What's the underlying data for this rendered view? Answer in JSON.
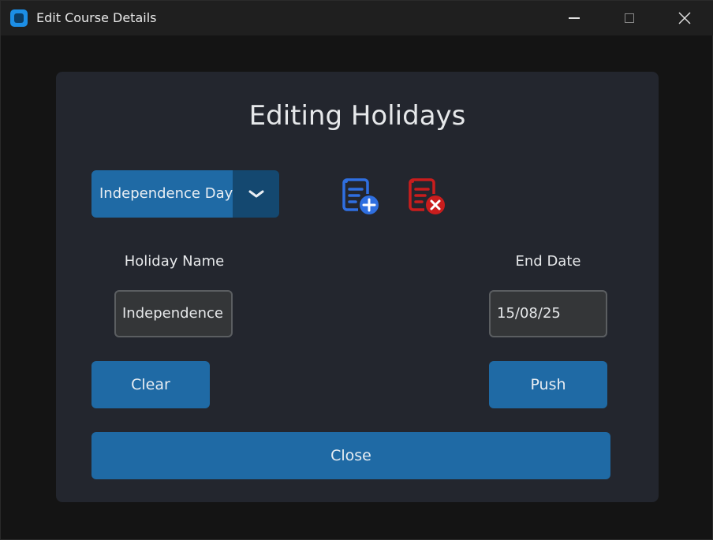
{
  "window": {
    "title": "Edit Course Details",
    "controls": [
      "minimize-icon",
      "maximize-icon",
      "close-icon"
    ]
  },
  "panel": {
    "heading": "Editing Holidays",
    "holiday_select": {
      "selected": "Independence Day",
      "arrow_icon": "chevron-down-icon"
    },
    "add_icon": "add-list-icon",
    "delete_icon": "delete-list-icon",
    "holiday_name": {
      "label": "Holiday Name",
      "value": "Independence"
    },
    "end_date": {
      "label": "End Date",
      "value": "15/08/25"
    },
    "buttons": {
      "clear": "Clear",
      "push": "Push",
      "close": "Close"
    }
  },
  "colors": {
    "accent": "#1f6aa5",
    "accent_dark": "#144870",
    "panel_bg": "#23262e",
    "add_icon": "#2f6fe0",
    "delete_icon": "#d21f1f"
  }
}
